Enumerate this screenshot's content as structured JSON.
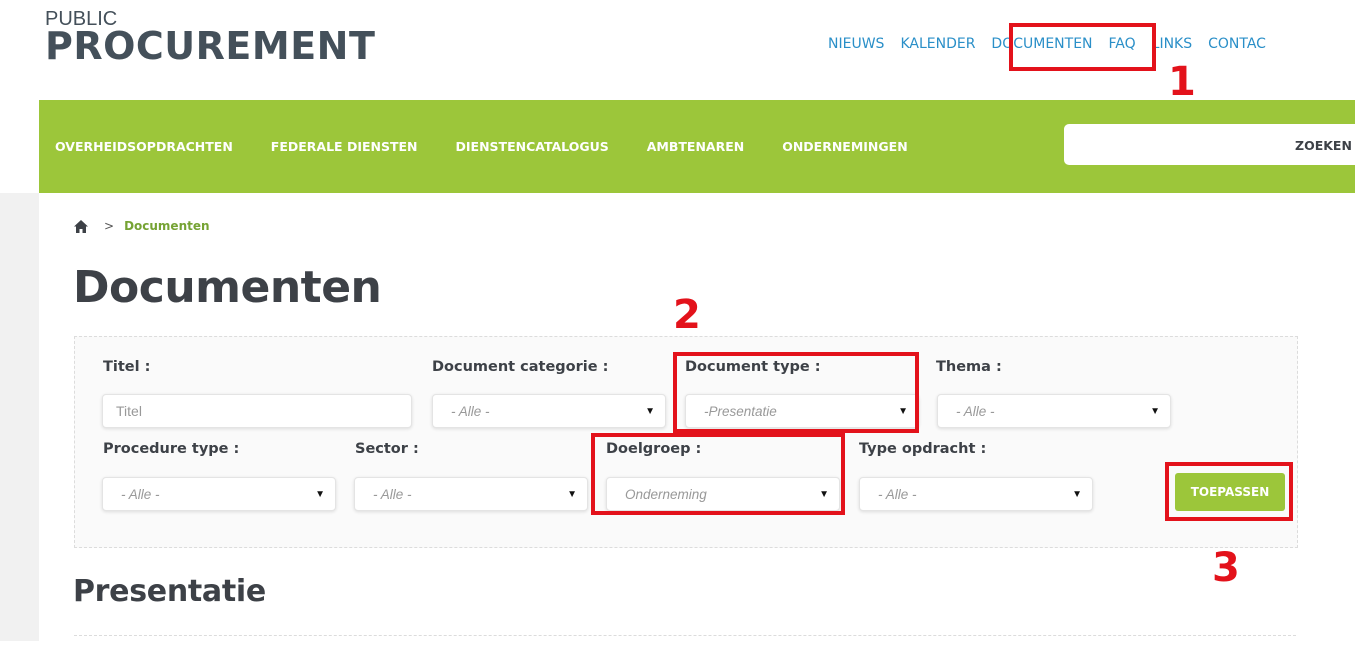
{
  "logo": {
    "line1": "PUBLIC",
    "line2": "PROCUREMENT"
  },
  "top_nav": [
    "NIEUWS",
    "KALENDER",
    "DOCUMENTEN",
    "FAQ",
    "LINKS",
    "CONTAC"
  ],
  "main_nav": [
    "OVERHEIDSOPDRACHTEN",
    "FEDERALE DIENSTEN",
    "DIENSTENCATALOGUS",
    "AMBTENAREN",
    "ONDERNEMINGEN"
  ],
  "search": {
    "button_label": "ZOEKEN",
    "value": ""
  },
  "breadcrumb": {
    "separator": ">",
    "current": "Documenten"
  },
  "page_title": "Documenten",
  "filters": {
    "titel": {
      "label": "Titel :",
      "placeholder": "Titel"
    },
    "document_categorie": {
      "label": "Document categorie :",
      "value": "- Alle -"
    },
    "document_type": {
      "label": "Document type :",
      "value": "-Presentatie"
    },
    "thema": {
      "label": "Thema :",
      "value": "- Alle -"
    },
    "procedure_type": {
      "label": "Procedure type :",
      "value": "- Alle -"
    },
    "sector": {
      "label": "Sector :",
      "value": "- Alle -"
    },
    "doelgroep": {
      "label": "Doelgroep :",
      "value": "Onderneming"
    },
    "type_opdracht": {
      "label": "Type opdracht :",
      "value": "- Alle -"
    },
    "apply_label": "TOEPASSEN",
    "dropdown_arrow": "▼"
  },
  "section_title": "Presentatie",
  "annotations": [
    "1",
    "2",
    "3"
  ],
  "colors": {
    "brand_green": "#9cc63a",
    "link_blue": "#2a8fc8",
    "annotation_red": "#e3121b",
    "text_dark": "#3d4147"
  }
}
